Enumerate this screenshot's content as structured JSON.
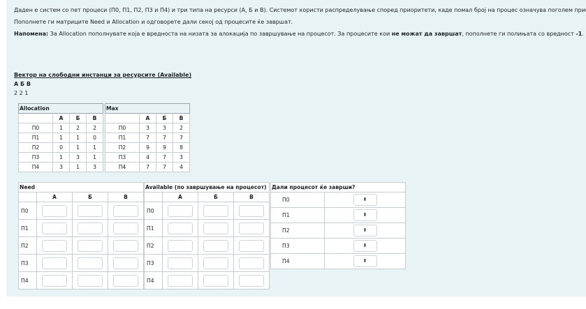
{
  "intro": {
    "line1": "Даден е систем со пет процеси (П0, П1, П2, П3 и П4) и три типа на ресурси (А, Б и В). Системот користи распределување според приоритети, каде помал број на процес означува поголем приоритет.",
    "line2": "Пополнете ги матриците Need и Allocation и одговорете дали секој од процесите ќе завршат.",
    "note_label": "Напомена:",
    "note_text1": " За Allocation пополнувате која е вредноста на низата за алокација по завршување на процесот. За процесите кои ",
    "note_bold": "не можат да завршат",
    "note_text2": ", пополнете ги полињата со вредност ",
    "note_value": "-1",
    "note_end": "."
  },
  "available": {
    "title": "Вектор на слободни инстанци за ресурсите (Available)",
    "header": "А Б В",
    "values": "2 2 1"
  },
  "resources": [
    "А",
    "Б",
    "В"
  ],
  "processes": [
    "П0",
    "П1",
    "П2",
    "П3",
    "П4"
  ],
  "allocation": {
    "caption": "Allocation",
    "rows": [
      [
        "1",
        "2",
        "2"
      ],
      [
        "1",
        "1",
        "0"
      ],
      [
        "0",
        "1",
        "1"
      ],
      [
        "1",
        "3",
        "1"
      ],
      [
        "3",
        "1",
        "3"
      ]
    ]
  },
  "max": {
    "caption": "Max",
    "rows": [
      [
        "3",
        "3",
        "2"
      ],
      [
        "7",
        "7",
        "7"
      ],
      [
        "9",
        "9",
        "8"
      ],
      [
        "4",
        "7",
        "3"
      ],
      [
        "7",
        "7",
        "4"
      ]
    ]
  },
  "need": {
    "caption": "Need"
  },
  "available_after": {
    "caption": "Available (по завршување на процесот)"
  },
  "finish": {
    "caption": "Дали процесот ќе заврши?",
    "select_symbol": "⬍"
  }
}
